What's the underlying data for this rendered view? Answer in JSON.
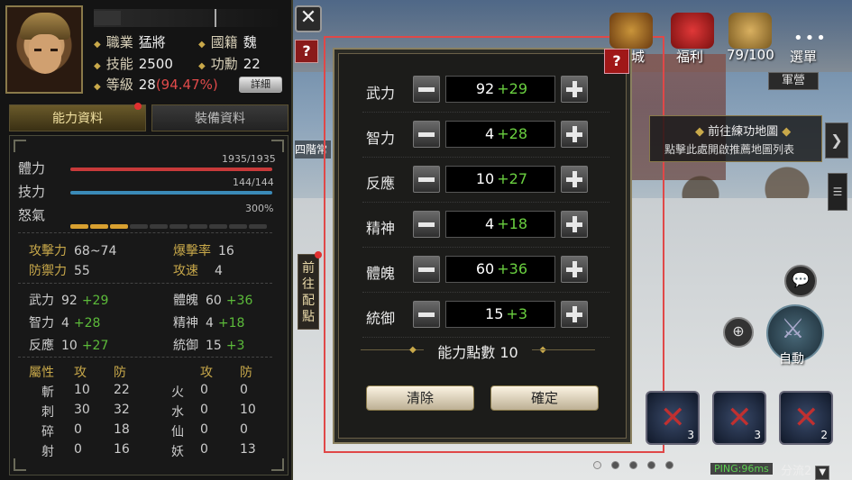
{
  "character": {
    "job_label": "職業",
    "job": "猛將",
    "nation_label": "國籍",
    "nation": "魏",
    "skill_label": "技能",
    "skill": "2500",
    "merit_label": "功勳",
    "merit": "22",
    "level_label": "等級",
    "level": "28",
    "level_pct": "(94.47%)",
    "detail_button": "詳細"
  },
  "tabs": {
    "ability": "能力資料",
    "equipment": "裝備資料"
  },
  "bars": {
    "hp_label": "體力",
    "hp_value": "1935/1935",
    "hp_fill": 1.0,
    "hp_color": "#c83a3a",
    "sp_label": "技力",
    "sp_value": "144/144",
    "sp_fill": 1.0,
    "sp_color": "#3a8ab8",
    "rage_label": "怒氣",
    "rage_value": "300%",
    "rage_on": 3,
    "rage_total": 10
  },
  "combat": {
    "atk_label": "攻擊力",
    "atk": "68~74",
    "crit_label": "爆擊率",
    "crit": "16",
    "def_label": "防禦力",
    "def": "55",
    "spd_label": "攻速",
    "spd": "4"
  },
  "attrs_left": {
    "wu_label": "武力",
    "wu": "92",
    "wu_b": "+29",
    "zhi_label": "智力",
    "zhi": "4",
    "zhi_b": "+28",
    "fan_label": "反應",
    "fan": "10",
    "fan_b": "+27",
    "ti_label": "體魄",
    "ti": "60",
    "ti_b": "+36",
    "jing_label": "精神",
    "jing": "4",
    "jing_b": "+18",
    "tong_label": "統御",
    "tong": "15",
    "tong_b": "+3"
  },
  "resist": {
    "header": [
      "屬性",
      "攻",
      "防",
      "攻",
      "防"
    ],
    "rows": [
      [
        "斬",
        "10",
        "22",
        "火",
        "0",
        "0"
      ],
      [
        "刺",
        "30",
        "32",
        "水",
        "0",
        "10"
      ],
      [
        "碎",
        "0",
        "18",
        "仙",
        "0",
        "0"
      ],
      [
        "射",
        "0",
        "16",
        "妖",
        "0",
        "13"
      ]
    ]
  },
  "dialog": {
    "rows": [
      {
        "label": "武力",
        "value": "92",
        "bonus": "+29"
      },
      {
        "label": "智力",
        "value": "4",
        "bonus": "+28"
      },
      {
        "label": "反應",
        "value": "10",
        "bonus": "+27"
      },
      {
        "label": "精神",
        "value": "4",
        "bonus": "+18"
      },
      {
        "label": "體魄",
        "value": "60",
        "bonus": "+36"
      },
      {
        "label": "統御",
        "value": "15",
        "bonus": "+3"
      }
    ],
    "points_label": "能力點數 10",
    "clear_button": "清除",
    "confirm_button": "確定",
    "help": "?"
  },
  "hud": {
    "menu_city": "城",
    "menu_welfare": "福利",
    "menu_count": "79/100",
    "menu_select": "選單",
    "camp": "軍營",
    "nav_title": "前往練功地圖",
    "nav_desc": "點擊此處開啟推薦地圖列表",
    "side_goto": "前往配點",
    "floor_tag": "四階常",
    "auto": "自動",
    "ping": "PING:96ms",
    "line": "分流2",
    "skill_counts": [
      "3",
      "3",
      "2"
    ]
  }
}
